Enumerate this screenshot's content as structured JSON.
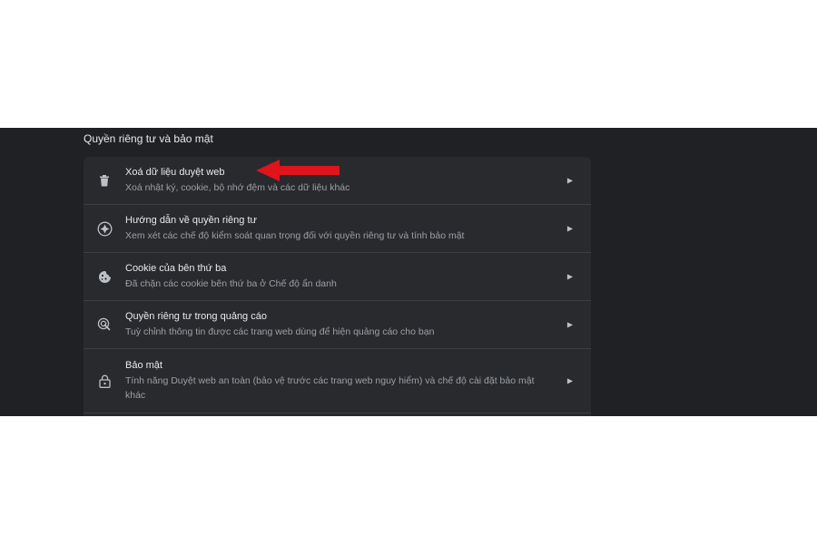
{
  "section": {
    "title": "Quyền riêng tư và bảo mật"
  },
  "items": [
    {
      "label": "Xoá dữ liệu duyệt web",
      "desc": "Xoá nhật ký, cookie, bộ nhớ đệm và các dữ liệu khác",
      "icon": "trash-icon"
    },
    {
      "label": "Hướng dẫn về quyền riêng tư",
      "desc": "Xem xét các chế độ kiểm soát quan trọng đối với quyền riêng tư và tính bảo mật",
      "icon": "privacy-guide-icon"
    },
    {
      "label": "Cookie của bên thứ ba",
      "desc": "Đã chặn các cookie bên thứ ba ở Chế độ ẩn danh",
      "icon": "cookie-icon"
    },
    {
      "label": "Quyền riêng tư trong quảng cáo",
      "desc": "Tuỳ chỉnh thông tin được các trang web dùng để hiện quảng cáo cho bạn",
      "icon": "ad-privacy-icon"
    },
    {
      "label": "Bảo mật",
      "desc": "Tính năng Duyệt web an toàn (bảo vệ trước các trang web nguy hiểm) và chế độ cài đặt bảo mật khác",
      "icon": "lock-icon"
    }
  ],
  "colors": {
    "background": "#202124",
    "card": "#292a2d",
    "annotation_arrow": "#e0141b"
  }
}
